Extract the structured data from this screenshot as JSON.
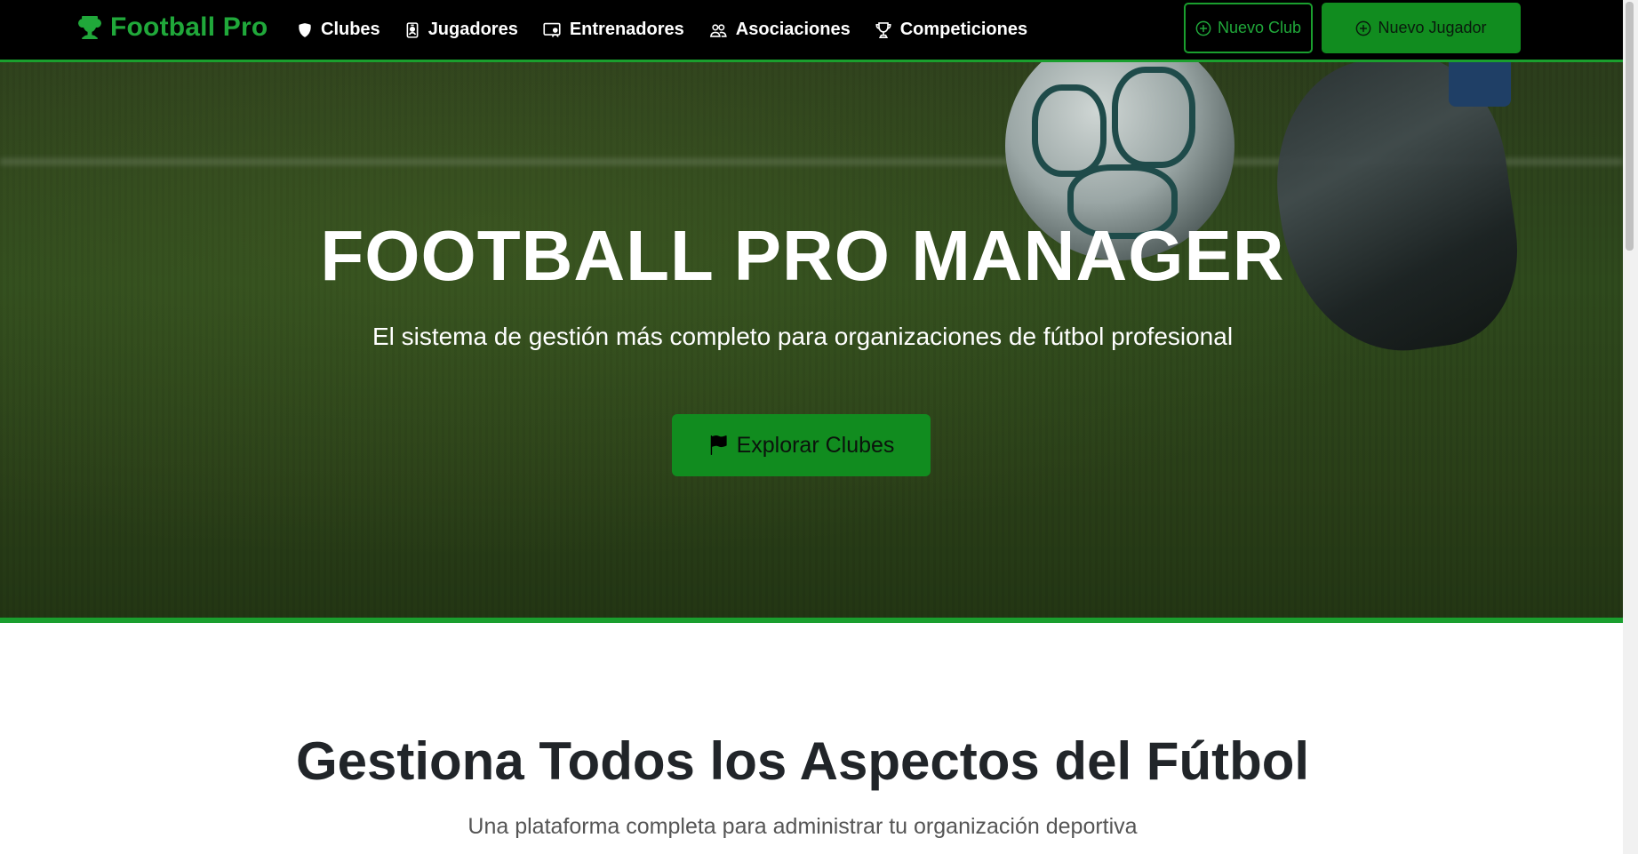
{
  "navbar": {
    "brand": "Football Pro",
    "links": [
      {
        "label": "Clubes",
        "icon": "shield-icon"
      },
      {
        "label": "Jugadores",
        "icon": "id-badge-icon"
      },
      {
        "label": "Entrenadores",
        "icon": "person-board-icon"
      },
      {
        "label": "Asociaciones",
        "icon": "people-icon"
      },
      {
        "label": "Competiciones",
        "icon": "trophy-icon"
      }
    ],
    "new_club_label": "Nuevo Club",
    "new_player_label": "Nuevo Jugador"
  },
  "hero": {
    "title": "FOOTBALL PRO MANAGER",
    "subtitle": "El sistema de gestión más completo para organizaciones de fútbol profesional",
    "cta_label": "Explorar Clubes"
  },
  "features": {
    "title": "Gestiona Todos los Aspectos del Fútbol",
    "subtitle": "Una plataforma completa para administrar tu organización deportiva"
  },
  "colors": {
    "accent": "#1a9f2e",
    "button": "#118c1f",
    "navbar_bg": "#000000"
  }
}
